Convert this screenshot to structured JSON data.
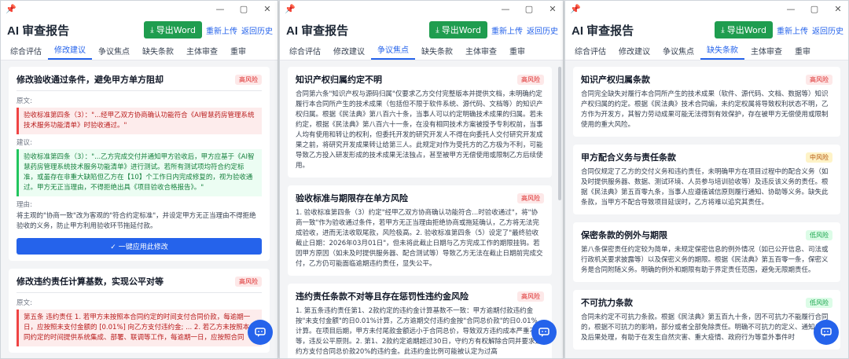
{
  "common": {
    "app_title": "AI 审查报告",
    "export_label": "导出Word",
    "reupload_label": "重新上传",
    "back_history_label": "返回历史",
    "back_history_label_short": "返回历",
    "window_min": "—",
    "window_max": "▢",
    "window_close": "✕",
    "tabs": [
      "综合评估",
      "修改建议",
      "争议焦点",
      "缺失条款",
      "主体审查",
      "重审"
    ],
    "badge_high": "高风险",
    "badge_mid": "中风险",
    "badge_low": "低风险"
  },
  "win1": {
    "active_tab": "修改建议",
    "cards": [
      {
        "title": "修改验收通过条件，避免甲方单方阻却",
        "original_label": "原文:",
        "original": "验收标准第四条（3）：\"...经甲乙双方协商确认功能符合《AI智慧药房管理系统技术服务功能清单》时验收通过。\"",
        "suggest_label": "建议:",
        "suggest": "验收标准第四条（3）：\"...乙方完成交付并通知甲方验收后，甲方应基于《AI智慧药房管理系统技术服务功能清单》进行测试。若所有测试项均符合约定标准，或虽存在非重大缺陷但乙方在【10】个工作日内完成修复的，视为验收通过。甲方无正当理由，不得拒绝出具《项目验收合格报告》。\"",
        "reason_label": "理由:",
        "reason": "将主观的\"协商一致\"改为客观的\"符合约定标准\"，并设定甲方无正当理由不得拒绝验收的义务，防止甲方利用验收环节拖延付款。",
        "apply_label": "✓ 一键应用此修改"
      },
      {
        "title": "修改违约责任计算基数，实现公平对等",
        "original_label": "原文:",
        "original": "第五条 违约责任 1. 若甲方未按照本合同约定的时间支付合同价款，每逾期一日，应按照未支付金额的 [0.01%] 向乙方支付违约金; ... 2. 若乙方未按照本合同约定的时间提供系统集成、部署、联调等工作，每逾期一日，应按照合同"
      }
    ]
  },
  "win2": {
    "active_tab": "争议焦点",
    "cards": [
      {
        "title": "知识产权归属约定不明",
        "body": "合同第六条\"知识产权与源码归属\"仅要求乙方交付完整版本并提供文档，未明确约定履行本合同所产生的技术成果（包括但不限于软件系统、源代码、文档等）的知识产权归属。根据《民法典》第八百六十条，当事人可以约定明确技术成果的归属。若未约定，根据《民法典》第八百六十一条，在没有相同技术方案被授予专利权前，当事人均有使用和转让的权利，但委托开发的研究开发人不得在向委托人交付研究开发成果之前，将研究开发成果转让给第三人。此规定对作为受托方的乙方极为不利，可能导致乙方投入研发形成的技术成果无法独占，甚至被甲方无偿使用或限制乙方后续使用。"
      },
      {
        "title": "验收标准与期限存在单方风险",
        "body": "1. 验收标准第四条（3）约定\"经甲乙双方协商确认功能符合...时验收通过\"，将\"协商一致\"作为验收通过条件，若甲方无正当理由拒绝协商或拖延确认，乙方将无法完成验收，进而无法收取尾款，风险极高。2. 验收标准第四条（5）设定了\"最终验收截止日期：2026年03月01日\"，但未将此截止日期与乙方完成工作的期限挂钩。若因甲方原因（如未及时提供服务器、配合测试等）导致乙方无法在截止日期前完成交付，乙方仍可能面临逾期违约责任，显失公平。"
      },
      {
        "title": "违约责任条款不对等且存在惩罚性违约金风险",
        "body": "1. 第五条违约责任第1、2款约定的违约金计算基数不一致：甲方逾期付款违约金按\"未支付金额\"的日0.01%计算，乙方逾期交付违约金按\"合同总价款\"的日0.01%计算。在项目后期，甲方未付尾款金额远小于合同总价，导致双方违约成本严重不对等，违反公平原则。2. 第1、2款约定逾期超过30日，守约方有权解除合同并要求违约方支付合同总价款20%的违约金。此违约金比例可能被认定为过高"
      }
    ]
  },
  "win3": {
    "active_tab": "缺失条款",
    "cards": [
      {
        "title": "知识产权归属条款",
        "body": "合同完全缺失对履行本合同所产生的技术成果（软件、源代码、文档、数据等）知识产权归属的约定。根据《民法典》技术合同编，未约定权属将导致权利状态不明，乙方作为开发方，其智力劳动成果可能无法得到有效保护，存在被甲方无偿使用或限制使用的重大风险。"
      },
      {
        "title": "甲方配合义务与责任条款",
        "body": "合同仅规定了乙方的交付义务和违约责任，未明确甲方在项目过程中的配合义务（如及时提供服务器、数据、测试环境、人员参与培训验收等）及违反该义务的责任。根据《民法典》第五百零九条，当事人应遵循诚信原则履行通知、协助等义务。缺失此条款，当甲方不配合导致项目延误时，乙方将难以追究其责任。"
      },
      {
        "title": "保密条款的例外与期限",
        "body": "第八条保密责任约定较为简单，未规定保密信息的例外情况（如已公开信息、司法或行政机关要求披露等）以及保密义务的期限。根据《民法典》第五百零一条，保密义务是合同附随义务。明确的例外和期限有助于界定责任范围，避免无限期责任。"
      },
      {
        "title": "不可抗力条款",
        "body": "合同未约定不可抗力条款。根据《民法典》第五百九十条，因不可抗力不能履行合同的，根据不可抗力的影响，部分或者全部免除责任。明确不可抗力的定义、通知义务及后果处理，有助于在发生自然灾害、重大疫情、政府行为等意外事件时"
      }
    ]
  }
}
